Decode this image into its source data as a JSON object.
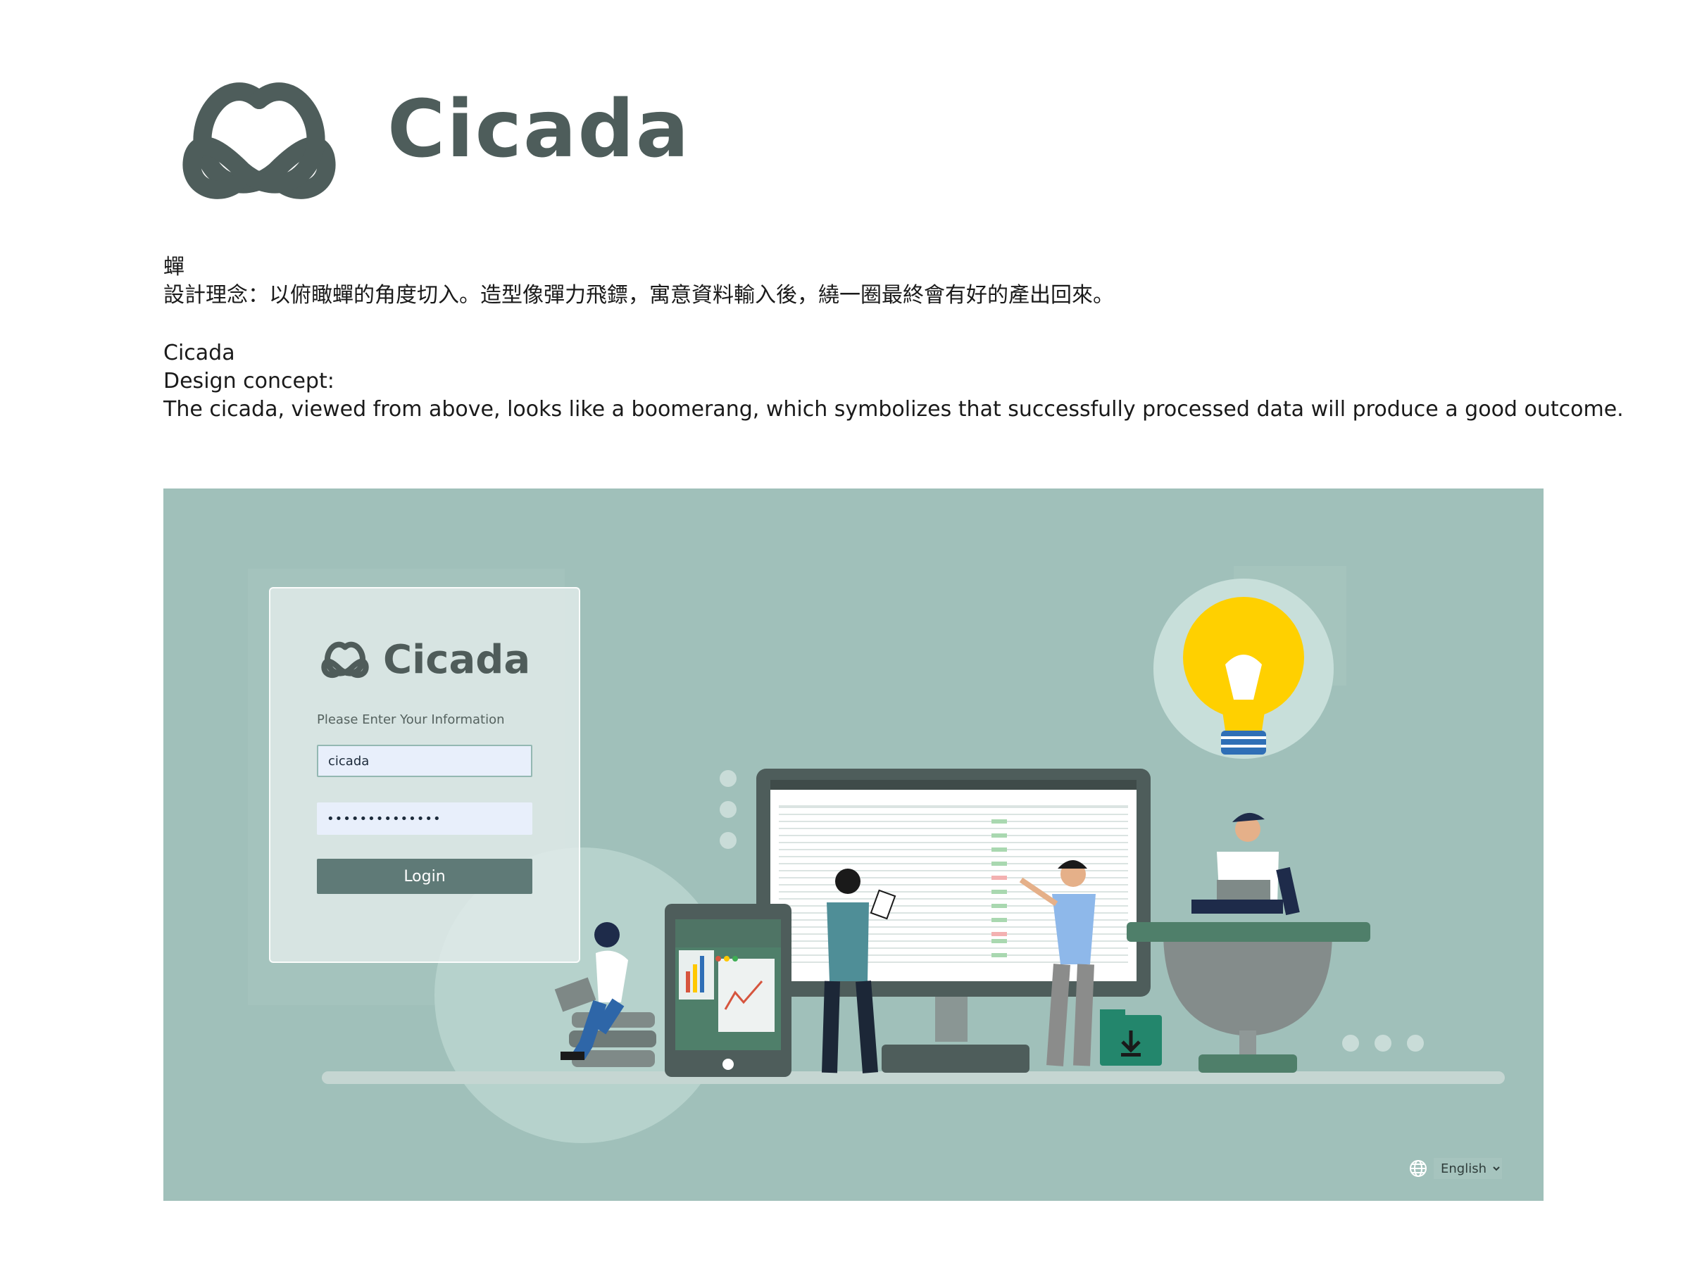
{
  "brand": {
    "wordmark": "Cicada",
    "logo_icon": "cicada-boomerang-logo",
    "color": "#4e5d5b"
  },
  "description": {
    "zh_title": "蟬",
    "zh_concept": "設計理念：以俯瞰蟬的角度切入。造型像彈力飛鏢，寓意資料輸入後，繞一圈最終會有好的產出回來。",
    "en_title": "Cicada",
    "en_concept_label": "Design concept:",
    "en_concept": "The cicada, viewed from above, looks like a boomerang, which symbolizes that successfully processed data will produce a good outcome."
  },
  "login": {
    "wordmark": "Cicada",
    "prompt": "Please Enter Your Information",
    "username_value": "cicada",
    "password_value": "••••••••••••••",
    "button_label": "Login"
  },
  "language": {
    "selected": "English",
    "icon": "globe-icon"
  },
  "colors": {
    "background": "#a0c0ba",
    "button": "#5f7a77",
    "bulb": "#ffd000",
    "accent_green": "#4f7f6a"
  }
}
